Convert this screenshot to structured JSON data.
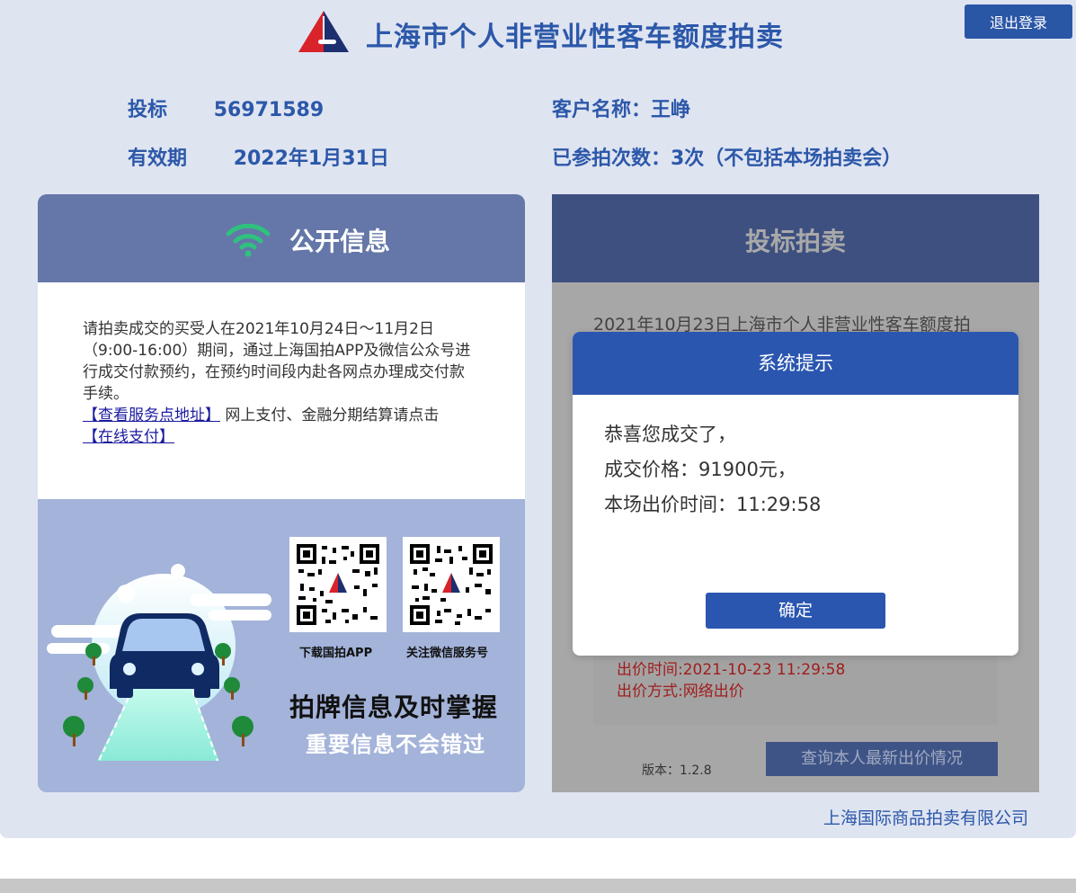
{
  "header": {
    "title": "上海市个人非营业性客车额度拍卖",
    "logout_label": "退出登录"
  },
  "bidder": {
    "bid_label": "投标",
    "bid_number": "56971589",
    "valid_label": "有效期",
    "valid_date": "2022年1月31日",
    "customer_name": "客户名称：王峥",
    "attempts": "已参拍次数：3次（不包括本场拍卖会）"
  },
  "public_info": {
    "title": "公开信息",
    "notice_text": "请拍卖成交的买受人在2021年10月24日～11月2日（9:00-16:00）期间，通过上海国拍APP及微信公众号进行成交付款预约，在预约时间段内赴各网点办理成交付款手续。",
    "service_link": "【查看服务点地址】",
    "online_text": " 网上支付、金融分期结算请点击",
    "pay_link": "【在线支付】",
    "qr_app_label": "下载国拍APP",
    "qr_wechat_label": "关注微信服务号",
    "promo_title": "拍牌信息及时掌握",
    "promo_subtitle": "重要信息不会错过"
  },
  "bidding": {
    "title": "投标拍卖",
    "auction_line": "2021年10月23日上海市个人非营业性客车额度拍",
    "bid_time": "出价时间:2021-10-23 11:29:58",
    "bid_method": "出价方式:网络出价",
    "version": "版本：1.2.8",
    "query_label": "查询本人最新出价情况"
  },
  "modal": {
    "title": "系统提示",
    "line1": "恭喜您成交了，",
    "line2": "成交价格：91900元，",
    "line3": "本场出价时间：11:29:58",
    "confirm_label": "确定"
  },
  "footer": {
    "company": "上海国际商品拍卖有限公司"
  },
  "colors": {
    "brand_blue": "#2c58a9",
    "page_bg": "#dfe4f1",
    "wifi_green": "#2ec27e",
    "overlay_gray": "#a7a7a7",
    "bid_red": "#a11d1d"
  },
  "icons": [
    "logo-icon",
    "wifi-icon",
    "qr-code-app",
    "qr-code-wechat",
    "car-illustration"
  ]
}
